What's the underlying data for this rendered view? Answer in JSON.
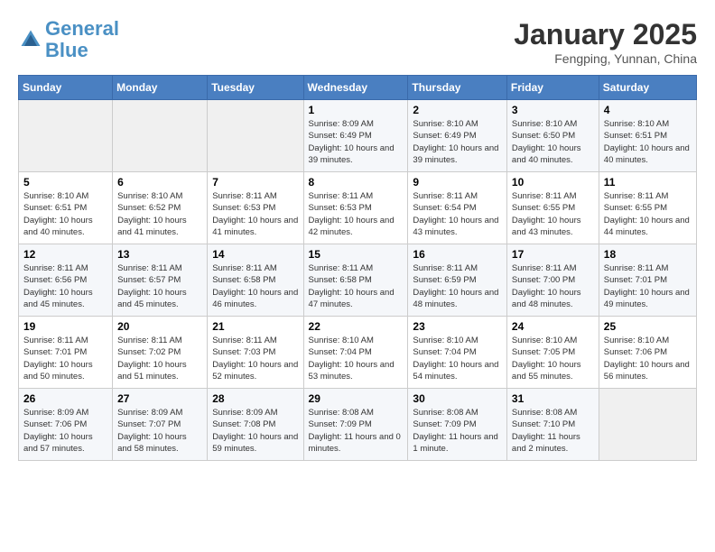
{
  "header": {
    "logo_line1": "General",
    "logo_line2": "Blue",
    "month": "January 2025",
    "location": "Fengping, Yunnan, China"
  },
  "weekdays": [
    "Sunday",
    "Monday",
    "Tuesday",
    "Wednesday",
    "Thursday",
    "Friday",
    "Saturday"
  ],
  "weeks": [
    [
      {
        "day": "",
        "empty": true
      },
      {
        "day": "",
        "empty": true
      },
      {
        "day": "",
        "empty": true
      },
      {
        "day": "1",
        "sunrise": "8:09 AM",
        "sunset": "6:49 PM",
        "daylight": "10 hours and 39 minutes."
      },
      {
        "day": "2",
        "sunrise": "8:10 AM",
        "sunset": "6:49 PM",
        "daylight": "10 hours and 39 minutes."
      },
      {
        "day": "3",
        "sunrise": "8:10 AM",
        "sunset": "6:50 PM",
        "daylight": "10 hours and 40 minutes."
      },
      {
        "day": "4",
        "sunrise": "8:10 AM",
        "sunset": "6:51 PM",
        "daylight": "10 hours and 40 minutes."
      }
    ],
    [
      {
        "day": "5",
        "sunrise": "8:10 AM",
        "sunset": "6:51 PM",
        "daylight": "10 hours and 40 minutes."
      },
      {
        "day": "6",
        "sunrise": "8:10 AM",
        "sunset": "6:52 PM",
        "daylight": "10 hours and 41 minutes."
      },
      {
        "day": "7",
        "sunrise": "8:11 AM",
        "sunset": "6:53 PM",
        "daylight": "10 hours and 41 minutes."
      },
      {
        "day": "8",
        "sunrise": "8:11 AM",
        "sunset": "6:53 PM",
        "daylight": "10 hours and 42 minutes."
      },
      {
        "day": "9",
        "sunrise": "8:11 AM",
        "sunset": "6:54 PM",
        "daylight": "10 hours and 43 minutes."
      },
      {
        "day": "10",
        "sunrise": "8:11 AM",
        "sunset": "6:55 PM",
        "daylight": "10 hours and 43 minutes."
      },
      {
        "day": "11",
        "sunrise": "8:11 AM",
        "sunset": "6:55 PM",
        "daylight": "10 hours and 44 minutes."
      }
    ],
    [
      {
        "day": "12",
        "sunrise": "8:11 AM",
        "sunset": "6:56 PM",
        "daylight": "10 hours and 45 minutes."
      },
      {
        "day": "13",
        "sunrise": "8:11 AM",
        "sunset": "6:57 PM",
        "daylight": "10 hours and 45 minutes."
      },
      {
        "day": "14",
        "sunrise": "8:11 AM",
        "sunset": "6:58 PM",
        "daylight": "10 hours and 46 minutes."
      },
      {
        "day": "15",
        "sunrise": "8:11 AM",
        "sunset": "6:58 PM",
        "daylight": "10 hours and 47 minutes."
      },
      {
        "day": "16",
        "sunrise": "8:11 AM",
        "sunset": "6:59 PM",
        "daylight": "10 hours and 48 minutes."
      },
      {
        "day": "17",
        "sunrise": "8:11 AM",
        "sunset": "7:00 PM",
        "daylight": "10 hours and 48 minutes."
      },
      {
        "day": "18",
        "sunrise": "8:11 AM",
        "sunset": "7:01 PM",
        "daylight": "10 hours and 49 minutes."
      }
    ],
    [
      {
        "day": "19",
        "sunrise": "8:11 AM",
        "sunset": "7:01 PM",
        "daylight": "10 hours and 50 minutes."
      },
      {
        "day": "20",
        "sunrise": "8:11 AM",
        "sunset": "7:02 PM",
        "daylight": "10 hours and 51 minutes."
      },
      {
        "day": "21",
        "sunrise": "8:11 AM",
        "sunset": "7:03 PM",
        "daylight": "10 hours and 52 minutes."
      },
      {
        "day": "22",
        "sunrise": "8:10 AM",
        "sunset": "7:04 PM",
        "daylight": "10 hours and 53 minutes."
      },
      {
        "day": "23",
        "sunrise": "8:10 AM",
        "sunset": "7:04 PM",
        "daylight": "10 hours and 54 minutes."
      },
      {
        "day": "24",
        "sunrise": "8:10 AM",
        "sunset": "7:05 PM",
        "daylight": "10 hours and 55 minutes."
      },
      {
        "day": "25",
        "sunrise": "8:10 AM",
        "sunset": "7:06 PM",
        "daylight": "10 hours and 56 minutes."
      }
    ],
    [
      {
        "day": "26",
        "sunrise": "8:09 AM",
        "sunset": "7:06 PM",
        "daylight": "10 hours and 57 minutes."
      },
      {
        "day": "27",
        "sunrise": "8:09 AM",
        "sunset": "7:07 PM",
        "daylight": "10 hours and 58 minutes."
      },
      {
        "day": "28",
        "sunrise": "8:09 AM",
        "sunset": "7:08 PM",
        "daylight": "10 hours and 59 minutes."
      },
      {
        "day": "29",
        "sunrise": "8:08 AM",
        "sunset": "7:09 PM",
        "daylight": "11 hours and 0 minutes."
      },
      {
        "day": "30",
        "sunrise": "8:08 AM",
        "sunset": "7:09 PM",
        "daylight": "11 hours and 1 minute."
      },
      {
        "day": "31",
        "sunrise": "8:08 AM",
        "sunset": "7:10 PM",
        "daylight": "11 hours and 2 minutes."
      },
      {
        "day": "",
        "empty": true
      }
    ]
  ]
}
